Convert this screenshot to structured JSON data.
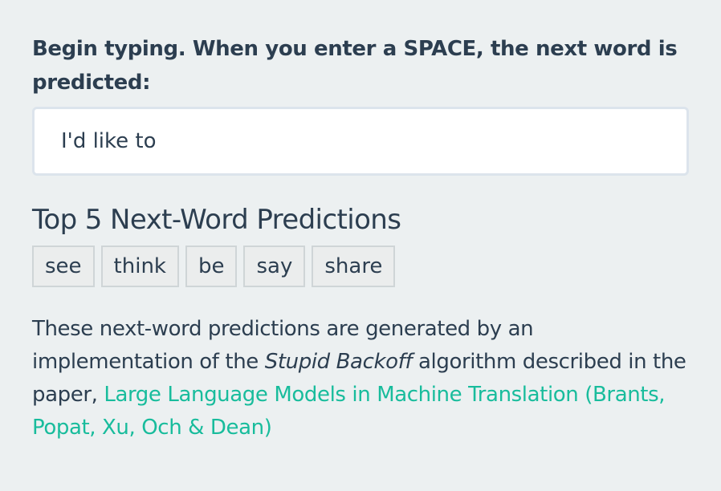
{
  "prompt": {
    "label": "Begin typing. When you enter a SPACE, the next word is predicted:"
  },
  "input": {
    "value": "I'd like to",
    "placeholder": ""
  },
  "predictions": {
    "title": "Top 5 Next-Word Predictions",
    "words": [
      "see",
      "think",
      "be",
      "say",
      "share"
    ]
  },
  "description": {
    "intro": "These next-word predictions are generated by an implementation of the ",
    "algorithm": "Stupid Backoff",
    "middle": " algorithm described in the paper, ",
    "link_text": "Large Language Models in Machine Translation (Brants, Popat, Xu, Och & Dean)"
  },
  "colors": {
    "background": "#ecf0f1",
    "text": "#2c3e50",
    "link": "#18bc9c",
    "input_border": "#dce4ec",
    "button_background": "#ebeded",
    "button_border": "#cfd5d7"
  }
}
